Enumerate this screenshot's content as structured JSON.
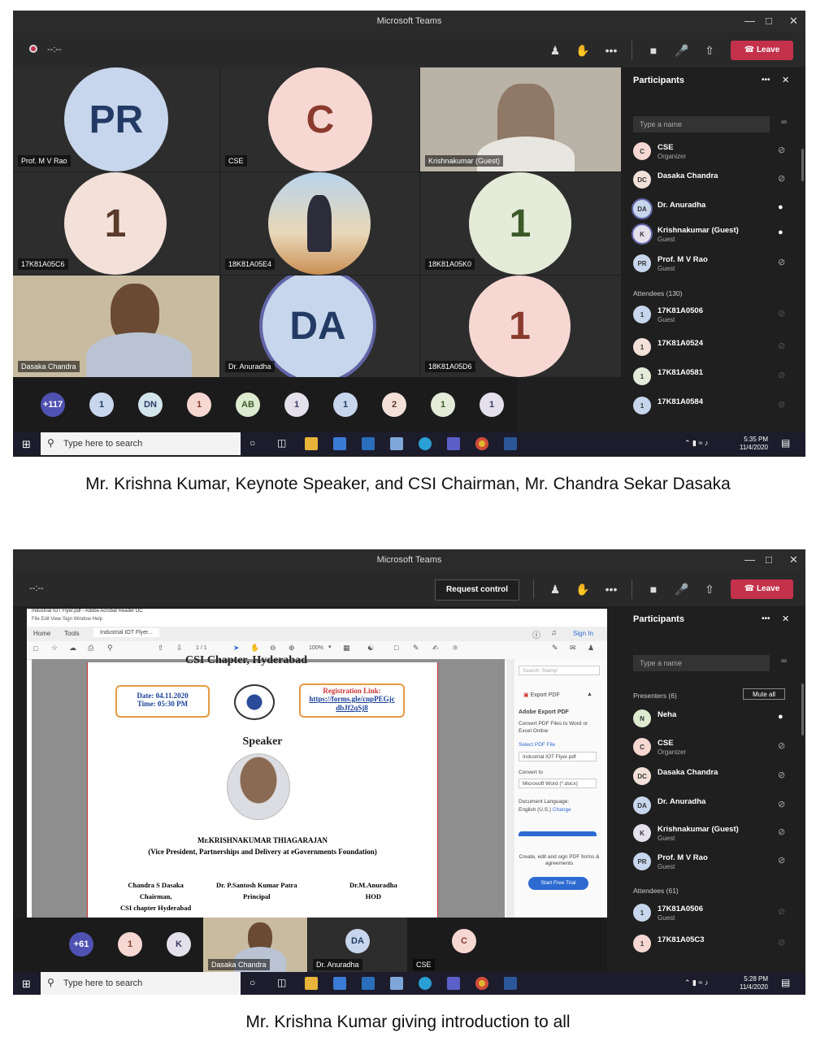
{
  "screenshot1": {
    "window_title": "Microsoft Teams",
    "timer": "--:--",
    "leave_label": "Leave",
    "tiles": [
      {
        "initials": "PR",
        "label": "Prof. M V Rao"
      },
      {
        "initials": "C",
        "label": "CSE"
      },
      {
        "initials": "",
        "label": "Krishnakumar (Guest)"
      },
      {
        "initials": "1",
        "label": "17K81A05C6"
      },
      {
        "initials": "",
        "label": "18K81A05E4"
      },
      {
        "initials": "1",
        "label": "18K81A05K0"
      },
      {
        "initials": "",
        "label": "Dasaka Chandra"
      },
      {
        "initials": "DA",
        "label": "Dr. Anuradha"
      },
      {
        "initials": "1",
        "label": "18K81A05D6"
      }
    ],
    "overflow": [
      "+117",
      "1",
      "DN",
      "1",
      "AB",
      "1",
      "1",
      "2",
      "1",
      "1"
    ],
    "panel": {
      "title": "Participants",
      "search_placeholder": "Type a name",
      "people": [
        {
          "initials": "C",
          "name": "CSE",
          "sub": "Organizer"
        },
        {
          "initials": "DC",
          "name": "Dasaka Chandra",
          "sub": ""
        },
        {
          "initials": "DA",
          "name": "Dr. Anuradha",
          "sub": ""
        },
        {
          "initials": "K",
          "name": "Krishnakumar (Guest)",
          "sub": "Guest"
        },
        {
          "initials": "PR",
          "name": "Prof. M V Rao",
          "sub": "Guest"
        }
      ],
      "attendees_label": "Attendees (130)",
      "attendees": [
        {
          "initials": "1",
          "name": "17K81A0506",
          "sub": "Guest"
        },
        {
          "initials": "1",
          "name": "17K81A0524",
          "sub": ""
        },
        {
          "initials": "1",
          "name": "17K81A0581",
          "sub": ""
        },
        {
          "initials": "1",
          "name": "17K81A0584",
          "sub": ""
        }
      ]
    },
    "taskbar": {
      "search": "Type here to search",
      "time": "5:35 PM",
      "date": "11/4/2020"
    }
  },
  "caption1": "Mr. Krishna Kumar, Keynote Speaker, and CSI Chairman, Mr. Chandra Sekar Dasaka",
  "screenshot2": {
    "window_title": "Microsoft Teams",
    "timer": "--:--",
    "request_control": "Request control",
    "leave_label": "Leave",
    "pdf": {
      "window_title": "Industrial IOT Flyer.pdf - Adobe Acrobat Reader DC",
      "menu": "File  Edit  View  Sign  Window  Help",
      "tabs": [
        "Home",
        "Tools",
        "Industrial IOT Flyer..."
      ],
      "sign_in": "Sign In",
      "page": "1 / 1",
      "zoom": "100%",
      "flyer": {
        "header": "CSI Chapter, Hyderabad",
        "date_line": "Date: 04.11.2020",
        "time_line": "Time:  05:30 PM",
        "reg_title": "Registration Link:",
        "reg_link": "https://forms.gle/cnpPEGjc dbJf2qSj8",
        "speaker_heading": "Speaker",
        "speaker_name": "Mr.KRISHNAKUMAR THIAGARAJAN",
        "speaker_role": "(Vice President, Partnerships and Delivery at eGovernments Foundation)",
        "sig1": [
          "Chandra S Dasaka",
          "Chairman,",
          "CSI chapter Hyderabad"
        ],
        "sig2": [
          "Dr. P.Santosh Kumar Patra",
          "Principal"
        ],
        "sig3": [
          "Dr.M.Anuradha",
          "HOD"
        ]
      },
      "side": {
        "search": "Search 'Stamp'",
        "export_label": "Export PDF",
        "adobe_export": "Adobe Export PDF",
        "convert_desc": "Convert PDF Files to Word or Excel Online",
        "select_file": "Select PDF File",
        "file_name": "Industrial IOT Flyer.pdf",
        "convert_to": "Convert to",
        "format": "Microsoft Word (*.docx)",
        "doc_lang": "Document Language:",
        "lang": "English (U.S.)",
        "change": "Change",
        "promo": "Create, edit and sign PDF forms & agreements",
        "trial": "Start Free Trial"
      }
    },
    "bottom_strip": [
      {
        "initials": "+61",
        "label": ""
      },
      {
        "initials": "1",
        "label": ""
      },
      {
        "initials": "K",
        "label": ""
      },
      {
        "initials": "",
        "label": "Dasaka Chandra"
      },
      {
        "initials": "DA",
        "label": "Dr. Anuradha"
      },
      {
        "initials": "C",
        "label": "CSE"
      }
    ],
    "panel": {
      "title": "Participants",
      "search_placeholder": "Type a name",
      "presenters_label": "Presenters (6)",
      "mute_all": "Mute all",
      "people": [
        {
          "initials": "N",
          "name": "Neha",
          "sub": ""
        },
        {
          "initials": "C",
          "name": "CSE",
          "sub": "Organizer"
        },
        {
          "initials": "DC",
          "name": "Dasaka Chandra",
          "sub": ""
        },
        {
          "initials": "DA",
          "name": "Dr. Anuradha",
          "sub": ""
        },
        {
          "initials": "K",
          "name": "Krishnakumar (Guest)",
          "sub": "Guest"
        },
        {
          "initials": "PR",
          "name": "Prof. M V Rao",
          "sub": "Guest"
        }
      ],
      "attendees_label": "Attendees (61)",
      "attendees": [
        {
          "initials": "1",
          "name": "17K81A0506",
          "sub": "Guest"
        },
        {
          "initials": "1",
          "name": "17K81A05C3",
          "sub": ""
        }
      ]
    },
    "taskbar": {
      "search": "Type here to search",
      "time": "5:28 PM",
      "date": "11/4/2020"
    }
  },
  "caption2": "Mr. Krishna Kumar giving introduction to all",
  "colors": {
    "teams_bg": "#1f1f1f",
    "leave_red": "#c4314b",
    "accent_purple": "#6264a7"
  }
}
